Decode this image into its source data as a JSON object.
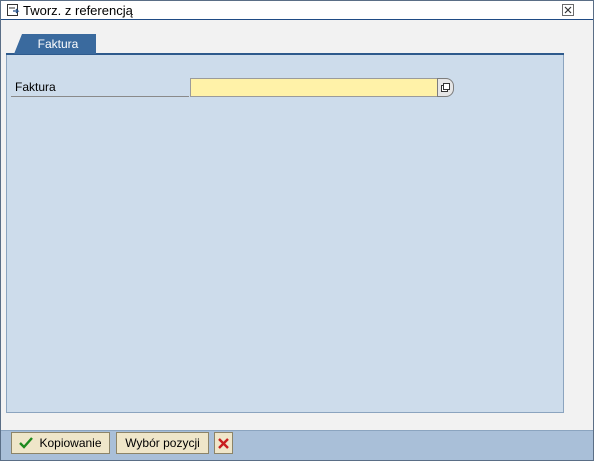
{
  "window": {
    "title": "Tworz. z referencją"
  },
  "tabs": [
    {
      "label": "Faktura"
    }
  ],
  "form": {
    "field_label": "Faktura",
    "field_value": ""
  },
  "footer": {
    "copy_label": "Kopiowanie",
    "select_items_label": "Wybór pozycji"
  },
  "icons": {
    "title": "window-icon",
    "close": "close-icon",
    "f4": "value-help-icon",
    "confirm": "checkmark-icon",
    "cancel": "cancel-icon"
  },
  "colors": {
    "tab": "#3a6a9e",
    "panel": "#cddceb",
    "input_required": "#fff2a8",
    "footer": "#a9bfd8",
    "button": "#efe6c9",
    "confirm_green": "#1e8a1e",
    "cancel_red": "#c81e1e"
  }
}
